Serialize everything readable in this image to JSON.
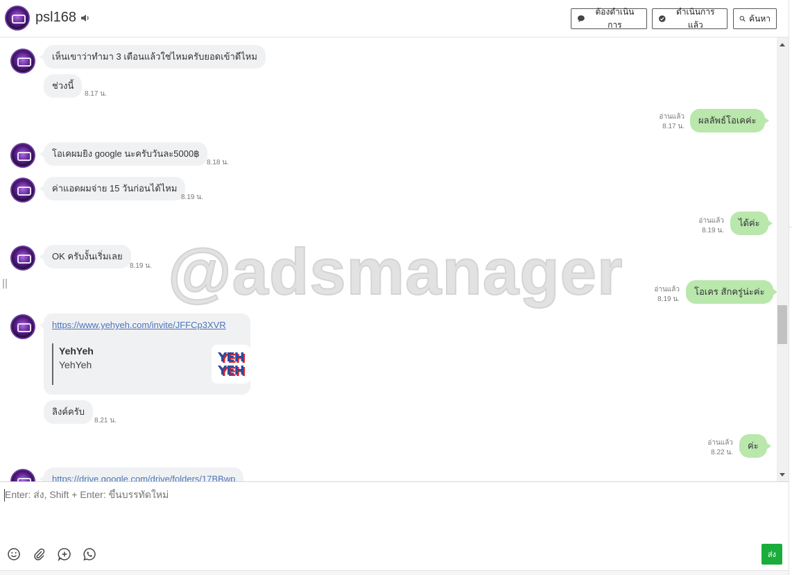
{
  "header": {
    "name": "psl168",
    "btn_todo": "ต้องดำเนินการ",
    "btn_done": "ดำเนินการแล้ว",
    "btn_search": "ค้นหา"
  },
  "messages": {
    "m1": "เห็นเขาว่าทำมา 3 เดือนแล้วใช่ไหมครับยอดเข้าดีไหม",
    "m2": "ช่วงนี้",
    "m2_time": "8.17 น.",
    "o1": "ผลลัพธ์โอเคค่ะ",
    "o1_read": "อ่านแล้ว",
    "o1_time": "8.17 น.",
    "m3": "โอเคผมยิง google นะครับวันละ5000฿",
    "m3_time": "8.18 น.",
    "m4": "ค่าแอดผมจ่าย 15 วันก่อนได้ไหม",
    "m4_time": "8.19 น.",
    "o2": "ได้ค่ะ",
    "o2_read": "อ่านแล้ว",
    "o2_time": "8.19 น.",
    "m5": "OK ครับงั้นเริ่มเลย",
    "m5_time": "8.19 น.",
    "o3": "โอเคร สักครู่น่ะค่ะ",
    "o3_read": "อ่านแล้ว",
    "o3_time": "8.19 น.",
    "link_url": "https://www.yehyeh.com/invite/JFFCp3XVR",
    "preview_title": "YehYeh",
    "preview_desc": "YehYeh",
    "logo_line1": "YEH",
    "logo_line2": "YEH",
    "m6": "ลิงค์ครับ",
    "m6_time": "8.21 น.",
    "o4": "ค่ะ",
    "o4_read": "อ่านแล้ว",
    "o4_time": "8.22 น.",
    "m7_link": "https://drive.google.com/drive/folders/17BBwp"
  },
  "watermark": "@adsmanager",
  "composer": {
    "placeholder": "Enter: ส่ง, Shift + Enter: ขึ้นบรรทัดใหม่",
    "send": "ส่ง"
  },
  "colors": {
    "outgoing_bubble": "#b9e7ac",
    "incoming_bubble": "#f0f1f3",
    "send_button": "#1aad3b",
    "link": "#4a74b8"
  }
}
